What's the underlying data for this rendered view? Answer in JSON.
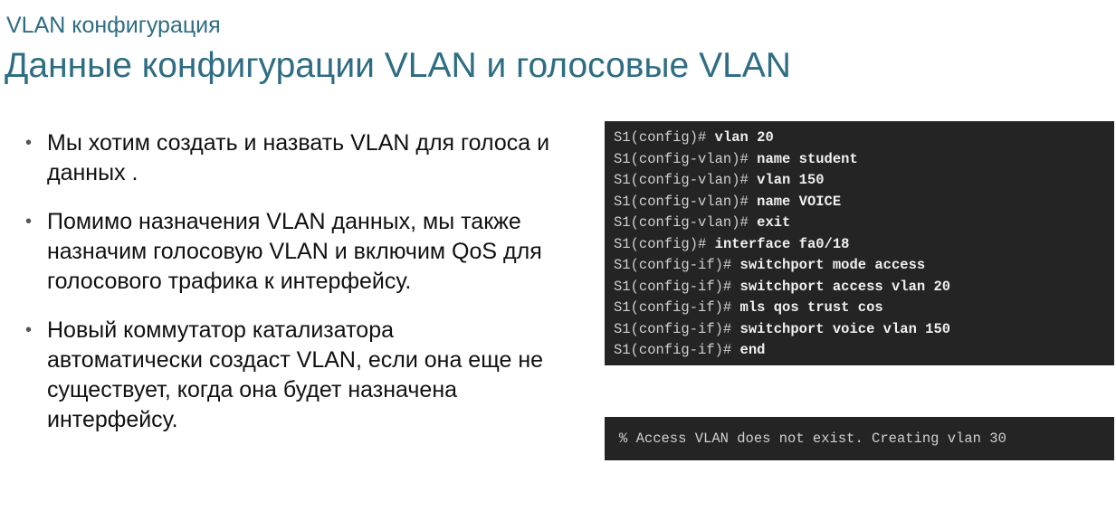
{
  "header": {
    "subtitle": "VLAN конфигурация",
    "title": "Данные конфигурации VLAN и голосовые VLAN"
  },
  "bullets": [
    "Мы хотим создать и назвать VLAN для голоса и данных .",
    "Помимо назначения VLAN данных, мы также назначим голосовую VLAN и включим QoS для голосового трафика к интерфейсу.",
    "Новый коммутатор катализатора автоматически создаст VLAN, если она еще не существует, когда она будет назначена интерфейсу."
  ],
  "bullet_symbol": "•",
  "config_terminal": {
    "lines": [
      {
        "prompt": "S1(config)#",
        "command": "vlan 20"
      },
      {
        "prompt": "S1(config-vlan)#",
        "command": "name student"
      },
      {
        "prompt": "S1(config-vlan)#",
        "command": "vlan 150"
      },
      {
        "prompt": "S1(config-vlan)#",
        "command": "name VOICE"
      },
      {
        "prompt": "S1(config-vlan)#",
        "command": "exit"
      },
      {
        "prompt": "S1(config)#",
        "command": "interface fa0/18"
      },
      {
        "prompt": "S1(config-if)#",
        "command": "switchport mode access"
      },
      {
        "prompt": "S1(config-if)#",
        "command": "switchport access vlan 20"
      },
      {
        "prompt": "S1(config-if)#",
        "command": "mls qos trust cos"
      },
      {
        "prompt": "S1(config-if)#",
        "command": "switchport voice vlan 150"
      },
      {
        "prompt": "S1(config-if)#",
        "command": "end"
      }
    ]
  },
  "message_terminal": {
    "text": "% Access VLAN does not exist. Creating vlan 30"
  },
  "colors": {
    "heading": "#2e6d83",
    "terminal_bg": "#242424",
    "terminal_text": "#d8d8d8"
  }
}
